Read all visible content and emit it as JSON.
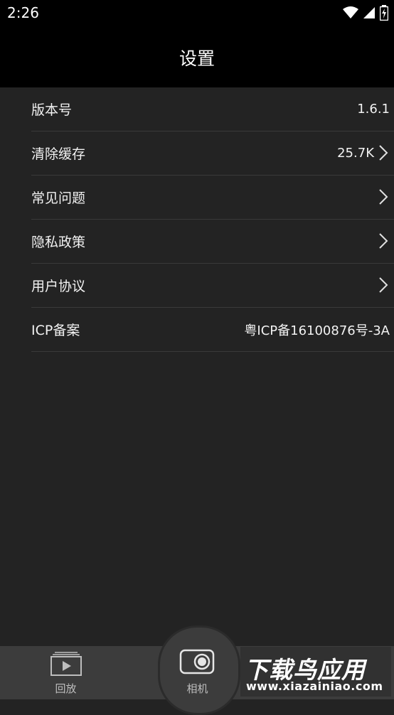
{
  "status": {
    "time": "2:26"
  },
  "header": {
    "title": "设置"
  },
  "settings": [
    {
      "label": "版本号",
      "value": "1.6.1",
      "arrow": false
    },
    {
      "label": "清除缓存",
      "value": "25.7K",
      "arrow": true
    },
    {
      "label": "常见问题",
      "value": "",
      "arrow": true
    },
    {
      "label": "隐私政策",
      "value": "",
      "arrow": true
    },
    {
      "label": "用户协议",
      "value": "",
      "arrow": true
    },
    {
      "label": "ICP备案",
      "value": "粤ICP备16100876号-3A",
      "arrow": false
    }
  ],
  "tabbar": {
    "playback_label": "回放",
    "camera_label": "相机"
  },
  "watermark": {
    "title": "下载鸟应用",
    "url": "www.xiazainiao.com"
  },
  "icons": [
    "wifi-icon",
    "signal-icon",
    "battery-icon",
    "chevron-right-icon",
    "playback-icon",
    "camera-icon"
  ]
}
